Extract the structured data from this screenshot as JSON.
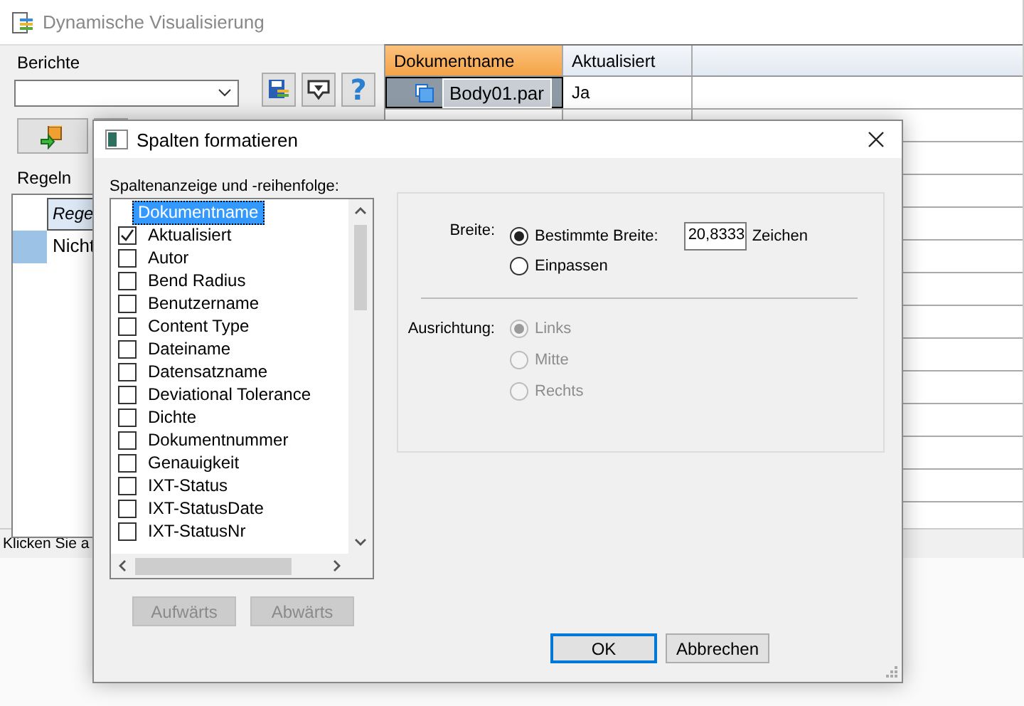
{
  "window": {
    "title": "Dynamische Visualisierung"
  },
  "reports": {
    "label": "Berichte",
    "help": "?"
  },
  "rules": {
    "label": "Regeln",
    "header": "Rege",
    "rows": [
      {
        "text": "Nicht",
        "selected": true
      }
    ]
  },
  "status_bar": "Klicken Sie a",
  "grid": {
    "columns": [
      {
        "label": "Dokumentname",
        "selected": true
      },
      {
        "label": "Aktualisiert",
        "selected": false
      }
    ],
    "rows": [
      {
        "cells": [
          "Body01.par",
          "Ja"
        ],
        "selected": true
      }
    ]
  },
  "dialog": {
    "title": "Spalten formatieren",
    "list_label": "Spaltenanzeige und -reihenfolge:",
    "items": [
      {
        "label": "Dokumentname",
        "kind": "plain",
        "selected": true
      },
      {
        "label": "Aktualisiert",
        "kind": "checkbox",
        "checked": true,
        "selected": false
      },
      {
        "label": "Autor",
        "kind": "checkbox",
        "checked": false,
        "selected": false
      },
      {
        "label": "Bend Radius",
        "kind": "checkbox",
        "checked": false,
        "selected": false
      },
      {
        "label": "Benutzername",
        "kind": "checkbox",
        "checked": false,
        "selected": false
      },
      {
        "label": "Content Type",
        "kind": "checkbox",
        "checked": false,
        "selected": false
      },
      {
        "label": "Dateiname",
        "kind": "checkbox",
        "checked": false,
        "selected": false
      },
      {
        "label": "Datensatzname",
        "kind": "checkbox",
        "checked": false,
        "selected": false
      },
      {
        "label": "Deviational Tolerance",
        "kind": "checkbox",
        "checked": false,
        "selected": false
      },
      {
        "label": "Dichte",
        "kind": "checkbox",
        "checked": false,
        "selected": false
      },
      {
        "label": "Dokumentnummer",
        "kind": "checkbox",
        "checked": false,
        "selected": false
      },
      {
        "label": "Genauigkeit",
        "kind": "checkbox",
        "checked": false,
        "selected": false
      },
      {
        "label": "IXT-Status",
        "kind": "checkbox",
        "checked": false,
        "selected": false
      },
      {
        "label": "IXT-StatusDate",
        "kind": "checkbox",
        "checked": false,
        "selected": false
      },
      {
        "label": "IXT-StatusNr",
        "kind": "checkbox",
        "checked": false,
        "selected": false
      }
    ],
    "width": {
      "label": "Breite:",
      "value": "20,8333",
      "unit": "Zeichen",
      "options": [
        {
          "label": "Bestimmte Breite:",
          "selected": true
        },
        {
          "label": "Einpassen",
          "selected": false
        }
      ]
    },
    "alignment": {
      "label": "Ausrichtung:",
      "disabled": true,
      "options": [
        {
          "label": "Links",
          "selected": true
        },
        {
          "label": "Mitte",
          "selected": false
        },
        {
          "label": "Rechts",
          "selected": false
        }
      ]
    },
    "move_buttons": [
      {
        "label": "Aufwärts",
        "disabled": true
      },
      {
        "label": "Abwärts",
        "disabled": true
      }
    ],
    "buttons": [
      {
        "label": "OK",
        "default": true
      },
      {
        "label": "Abbrechen",
        "default": false
      }
    ]
  }
}
